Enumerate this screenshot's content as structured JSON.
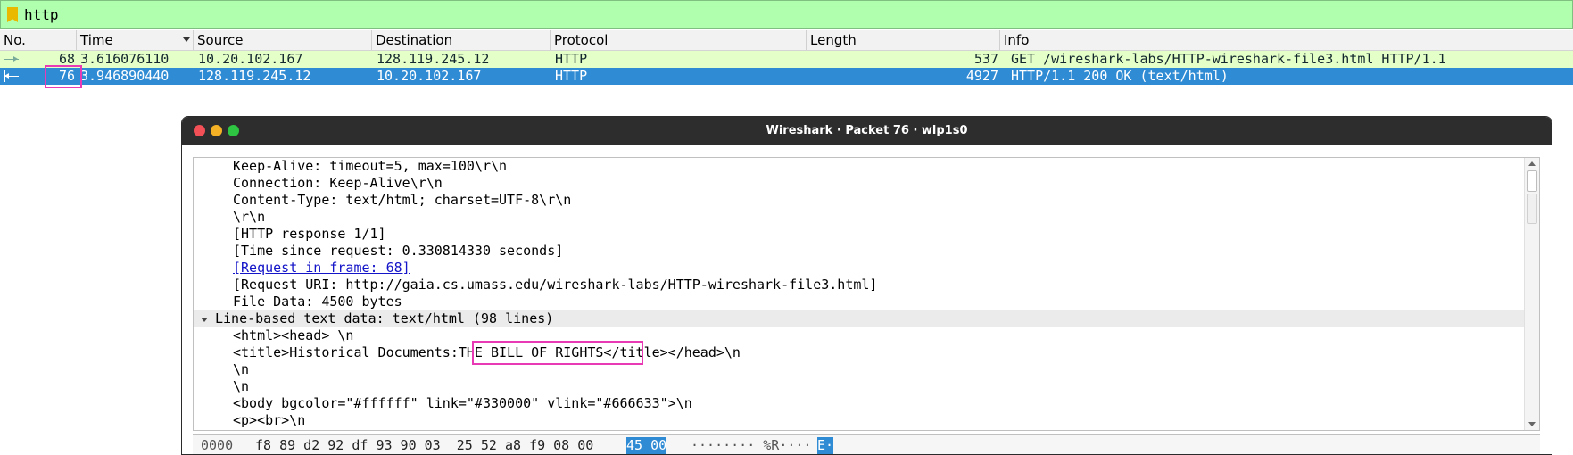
{
  "filter": {
    "value": "http"
  },
  "packet_list": {
    "columns": [
      "No.",
      "Time",
      "Source",
      "Destination",
      "Protocol",
      "Length",
      "Info"
    ],
    "rows": [
      {
        "no": "68",
        "time": "3.616076110",
        "source": "10.20.102.167",
        "destination": "128.119.245.12",
        "protocol": "HTTP",
        "length": "537",
        "info": "GET /wireshark-labs/HTTP-wireshark-file3.html HTTP/1.1"
      },
      {
        "no": "76",
        "time": "3.946890440",
        "source": "128.119.245.12",
        "destination": "10.20.102.167",
        "protocol": "HTTP",
        "length": "4927",
        "info": "HTTP/1.1 200 OK  (text/html)"
      }
    ]
  },
  "dialog": {
    "title": "Wireshark · Packet 76 · wlp1s0",
    "details": [
      "Keep-Alive: timeout=5, max=100\\r\\n",
      "Connection: Keep-Alive\\r\\n",
      "Content-Type: text/html; charset=UTF-8\\r\\n",
      "\\r\\n",
      "[HTTP response 1/1]",
      "[Time since request: 0.330814330 seconds]",
      "[Request in frame: 68]",
      "[Request URI: http://gaia.cs.umass.edu/wireshark-labs/HTTP-wireshark-file3.html]",
      "File Data: 4500 bytes",
      "Line-based text data: text/html (98 lines)",
      "<html><head> \\n",
      "<title>Historical Documents:THE BILL OF RIGHTS</title></head>\\n",
      "\\n",
      "\\n",
      "<body bgcolor=\"#ffffff\" link=\"#330000\" vlink=\"#666633\">\\n",
      "<p><br>\\n"
    ],
    "hex": {
      "offset": "0000",
      "bytes": "f8 89 d2 92 df 93 90 03  25 52 a8 f9 08 00",
      "selected_bytes": "45 00",
      "ascii": "········ %R····",
      "selected_ascii": "E·"
    }
  },
  "colors": {
    "filter_bg": "#afffaf",
    "row_http_bg": "#e4ffc7",
    "row_selected_bg": "#2f8bd4",
    "highlight_box": "#e83ab4",
    "titlebar_bg": "#2d2d2d"
  }
}
